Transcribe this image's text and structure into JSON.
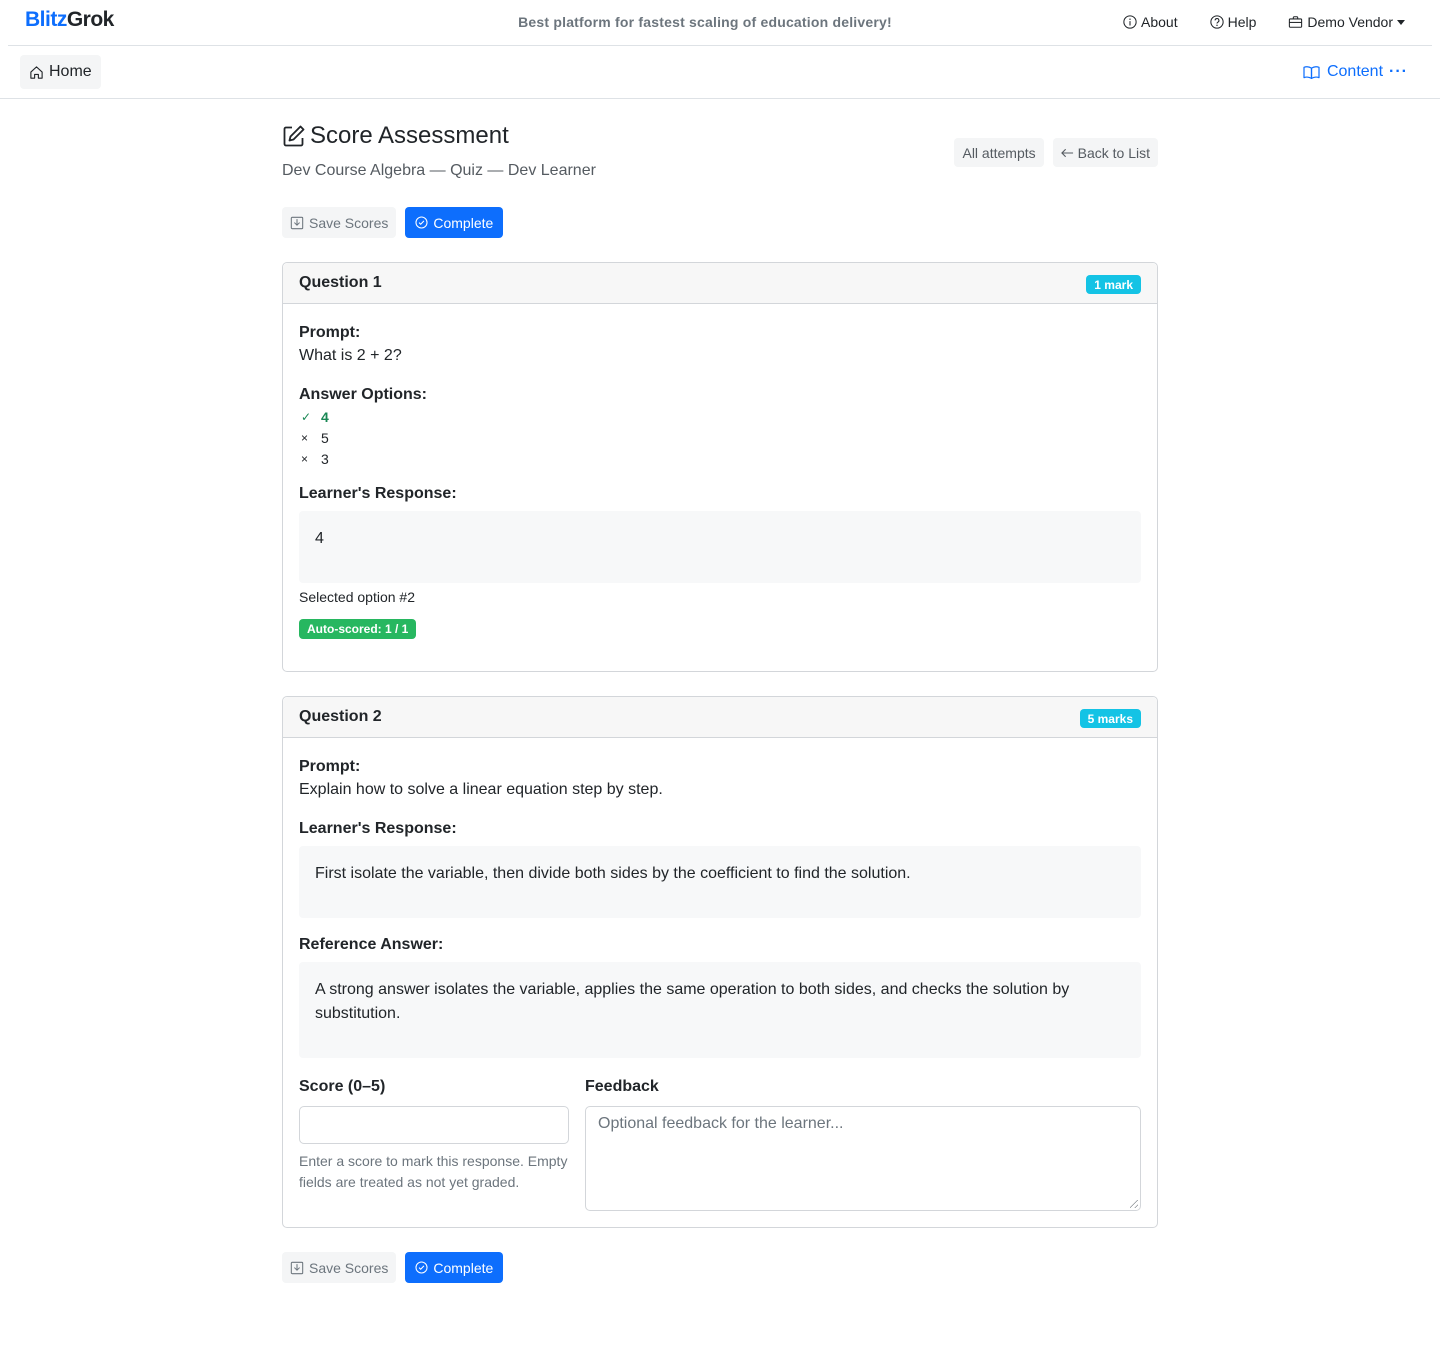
{
  "app": {
    "brand_part1": "Blitz",
    "brand_part2": "Grok",
    "tagline": "Best platform for fastest scaling of education delivery!"
  },
  "topnav": {
    "about": "About",
    "help": "Help",
    "vendor": "Demo Vendor"
  },
  "subnav": {
    "home": "Home",
    "content": "Content",
    "content_more": "···"
  },
  "page": {
    "title": "Score Assessment",
    "subtitle": "Dev Course Algebra — Quiz — Dev Learner",
    "all_attempts": "All attempts",
    "back_to_list": "Back to List"
  },
  "actions": {
    "save": "Save Scores",
    "complete": "Complete"
  },
  "questions": [
    {
      "title": "Question 1",
      "marks": "1 mark",
      "prompt_label": "Prompt:",
      "prompt": "What is 2 + 2?",
      "options_label": "Answer Options:",
      "options": [
        {
          "mark": "✓",
          "text": "4",
          "correct": true
        },
        {
          "mark": "×",
          "text": "5",
          "correct": false
        },
        {
          "mark": "×",
          "text": "3",
          "correct": false
        }
      ],
      "response_label": "Learner's Response:",
      "response": "4",
      "selected_note": "Selected option #2",
      "auto_score": "Auto-scored: 1 / 1"
    },
    {
      "title": "Question 2",
      "marks": "5 marks",
      "prompt_label": "Prompt:",
      "prompt": "Explain how to solve a linear equation step by step.",
      "response_label": "Learner's Response:",
      "response": "First isolate the variable, then divide both sides by the coefficient to find the solution.",
      "reference_label": "Reference Answer:",
      "reference": "A strong answer isolates the variable, applies the same operation to both sides, and checks the solution by substitution.",
      "score_label": "Score (0–5)",
      "score_value": "",
      "score_help": "Enter a score to mark this response. Empty fields are treated as not yet graded.",
      "feedback_label": "Feedback",
      "feedback_placeholder": "Optional feedback for the learner..."
    }
  ],
  "colors": {
    "primary": "#0d6efd",
    "info_badge": "#14c3e5",
    "success_badge": "#27b760",
    "correct_text": "#198754"
  }
}
